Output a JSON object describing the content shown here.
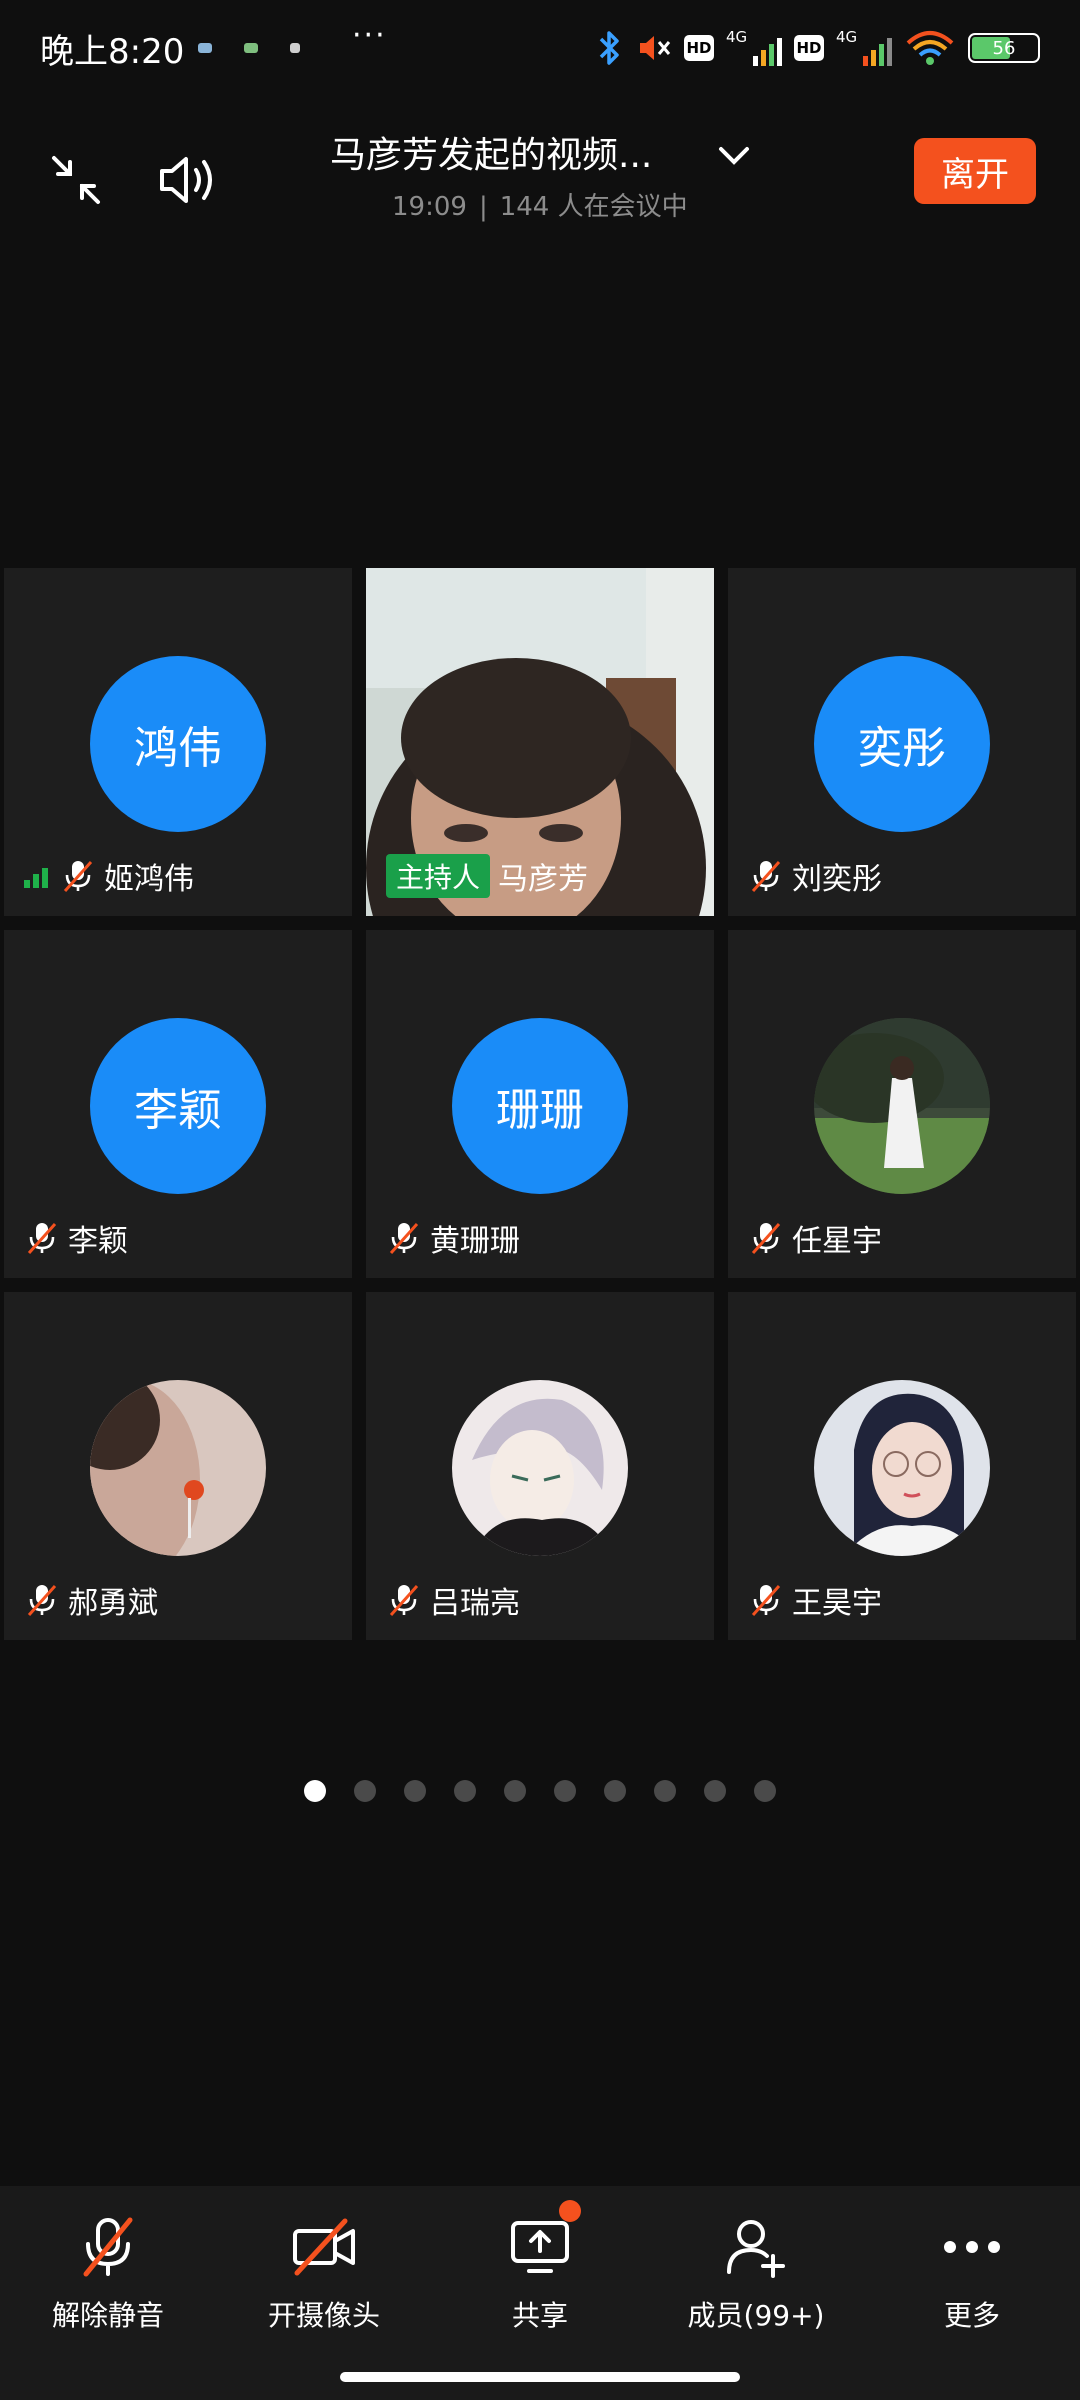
{
  "status_bar": {
    "time": "晚上8:20",
    "more": "···",
    "hd1": "HD",
    "net1": "4G",
    "hd2": "HD",
    "net2": "4G",
    "battery": "56"
  },
  "header": {
    "title": "马彦芳发起的视频...",
    "duration": "19:09",
    "separator": "|",
    "participants": "144 人在会议中",
    "leave_label": "离开"
  },
  "participants": [
    {
      "avatar_text": "鸿伟",
      "name": "姬鸿伟",
      "muted": true,
      "speaking": true
    },
    {
      "avatar_text": "",
      "name": "马彦芳",
      "host_badge": "主持人",
      "video": true
    },
    {
      "avatar_text": "奕彤",
      "name": "刘奕彤",
      "muted": true
    },
    {
      "avatar_text": "李颖",
      "name": "李颖",
      "muted": true
    },
    {
      "avatar_text": "珊珊",
      "name": "黄珊珊",
      "muted": true
    },
    {
      "avatar_text": "",
      "name": "任星宇",
      "muted": true,
      "photo": "girl-in-field"
    },
    {
      "avatar_text": "",
      "name": "郝勇斌",
      "muted": true,
      "photo": "boy-with-lollipop"
    },
    {
      "avatar_text": "",
      "name": "吕瑞亮",
      "muted": true,
      "photo": "anime-boy"
    },
    {
      "avatar_text": "",
      "name": "王昊宇",
      "muted": true,
      "photo": "girl-with-glasses"
    }
  ],
  "pagination": {
    "total_pages": 10,
    "current_page": 1
  },
  "toolbar": {
    "unmute": "解除静音",
    "camera": "开摄像头",
    "share": "共享",
    "members": "成员(99+)",
    "more": "更多"
  },
  "colors": {
    "accent_blue": "#1a8cf8",
    "leave_orange": "#f4511e",
    "host_green": "#1aa04a",
    "mute_red": "#f4511e"
  }
}
